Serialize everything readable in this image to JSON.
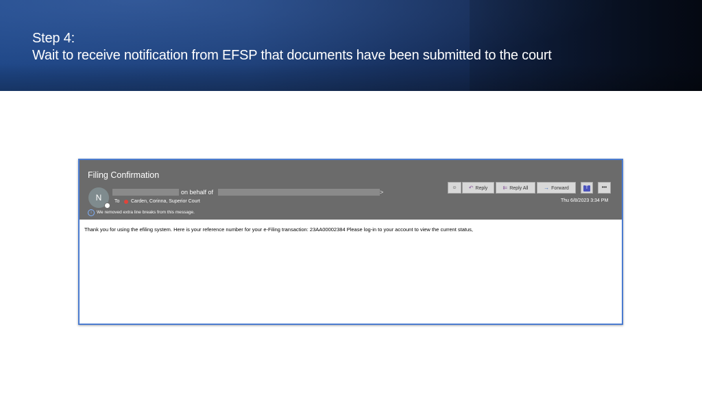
{
  "slide": {
    "step_label": "Step 4:",
    "step_description": "Wait to receive notification from EFSP that documents have been submitted to the court"
  },
  "email": {
    "subject": "Filing Confirmation",
    "avatar_initial": "N",
    "on_behalf_text": "on behalf of",
    "sender_suffix": ">",
    "to_label": "To",
    "to_recipient": "Carden, Corinna, Superior Court",
    "info_notice": "We removed extra line breaks from this message.",
    "date": "Thu 6/8/2023 3:34 PM",
    "body": "Thank you for using the efiling system.  Here is your reference number for your e-Filing transaction: 23AA00002384 Please log-in to your account to view the current status,"
  },
  "toolbar": {
    "emoji_glyph": "☺",
    "reply_icon_glyph": "↶",
    "reply_label": "Reply",
    "reply_all_icon_glyph": "⇇",
    "reply_all_label": "Reply All",
    "forward_icon_glyph": "→",
    "forward_label": "Forward",
    "teams_glyph": "T",
    "more_glyph": "•••"
  },
  "icons": {
    "info": "info-icon",
    "avatar": "avatar",
    "emoji": "emoji-icon",
    "reply": "reply-icon",
    "reply_all": "reply-all-icon",
    "forward": "forward-icon",
    "teams": "teams-icon",
    "more": "more-icon"
  },
  "colors": {
    "banner": "#1e4686",
    "email_header": "#6b6b6b",
    "frame_border": "#4a7bd0",
    "recipient_status": "#e0433a"
  }
}
